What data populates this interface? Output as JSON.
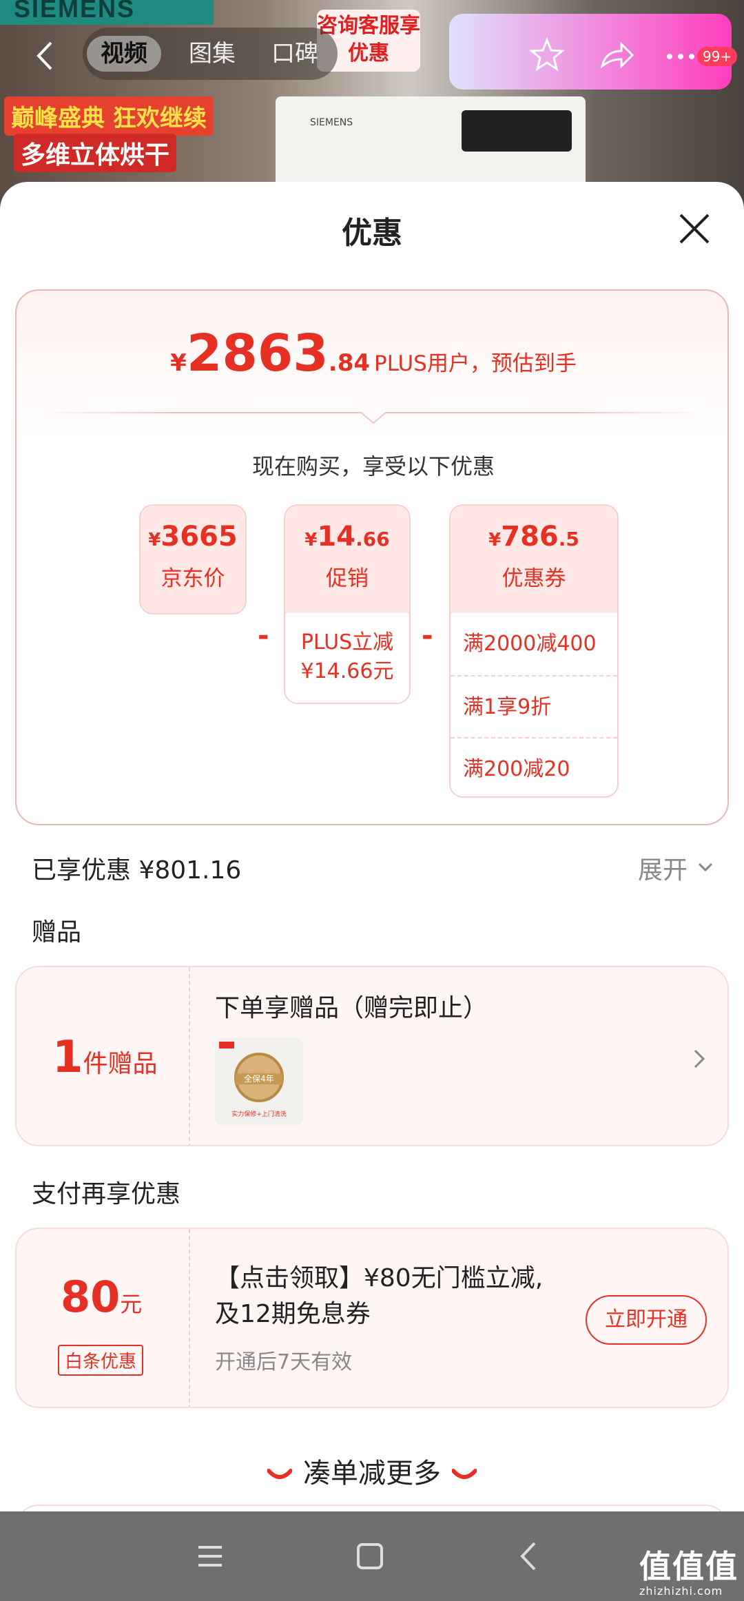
{
  "header": {
    "brand": "SIEMENS",
    "promo_line1": "巅峰盛典 狂欢继续",
    "promo_line2": "多维立体烘干",
    "consult_badge": "咨询客服享优惠",
    "washer_brand": "SIEMENS",
    "tabs": [
      "视频",
      "图集",
      "口碑"
    ],
    "active_tab": 0,
    "cart_count": "99+"
  },
  "sheet": {
    "title": "优惠",
    "final_price": {
      "currency": "¥",
      "integer": "2863",
      "decimal": ".84",
      "note": "PLUS用户，预估到手"
    },
    "buy_text": "现在购买，享受以下优惠",
    "jd_price": {
      "currency": "¥",
      "amount": "3665",
      "label": "京东价"
    },
    "promo": {
      "currency": "¥",
      "amount": "14",
      "decimal": ".66",
      "label": "促销",
      "rows": [
        "PLUS立减",
        "¥14.66元"
      ]
    },
    "coupon": {
      "currency": "¥",
      "amount": "786",
      "decimal": ".5",
      "label": "优惠券",
      "rows": [
        "满2000减400",
        "满1享9折",
        "满200减20"
      ]
    },
    "minus_sign": "-",
    "saved": "已享优惠 ¥801.16",
    "expand": "展开"
  },
  "gift": {
    "section_title": "赠品",
    "count": "1",
    "count_unit": "件赠品",
    "title": "下单享赠品（赠完即止）",
    "thumb_text": "全保4年",
    "thumb_caption": "实力保修+上门清洗"
  },
  "pay": {
    "section_title": "支付再享优惠",
    "amount": "80",
    "unit": "元",
    "tag": "白条优惠",
    "title": "【点击领取】¥80无门槛立减,及12期免息券",
    "subtitle": "开通后7天有效",
    "button": "立即开通"
  },
  "more": {
    "text": "凑单减更多"
  },
  "watermark": {
    "big": "值值值",
    "small": "zhizhizhi.com"
  },
  "colors": {
    "accent": "#e53023",
    "card_bg": "#fff6f5"
  }
}
